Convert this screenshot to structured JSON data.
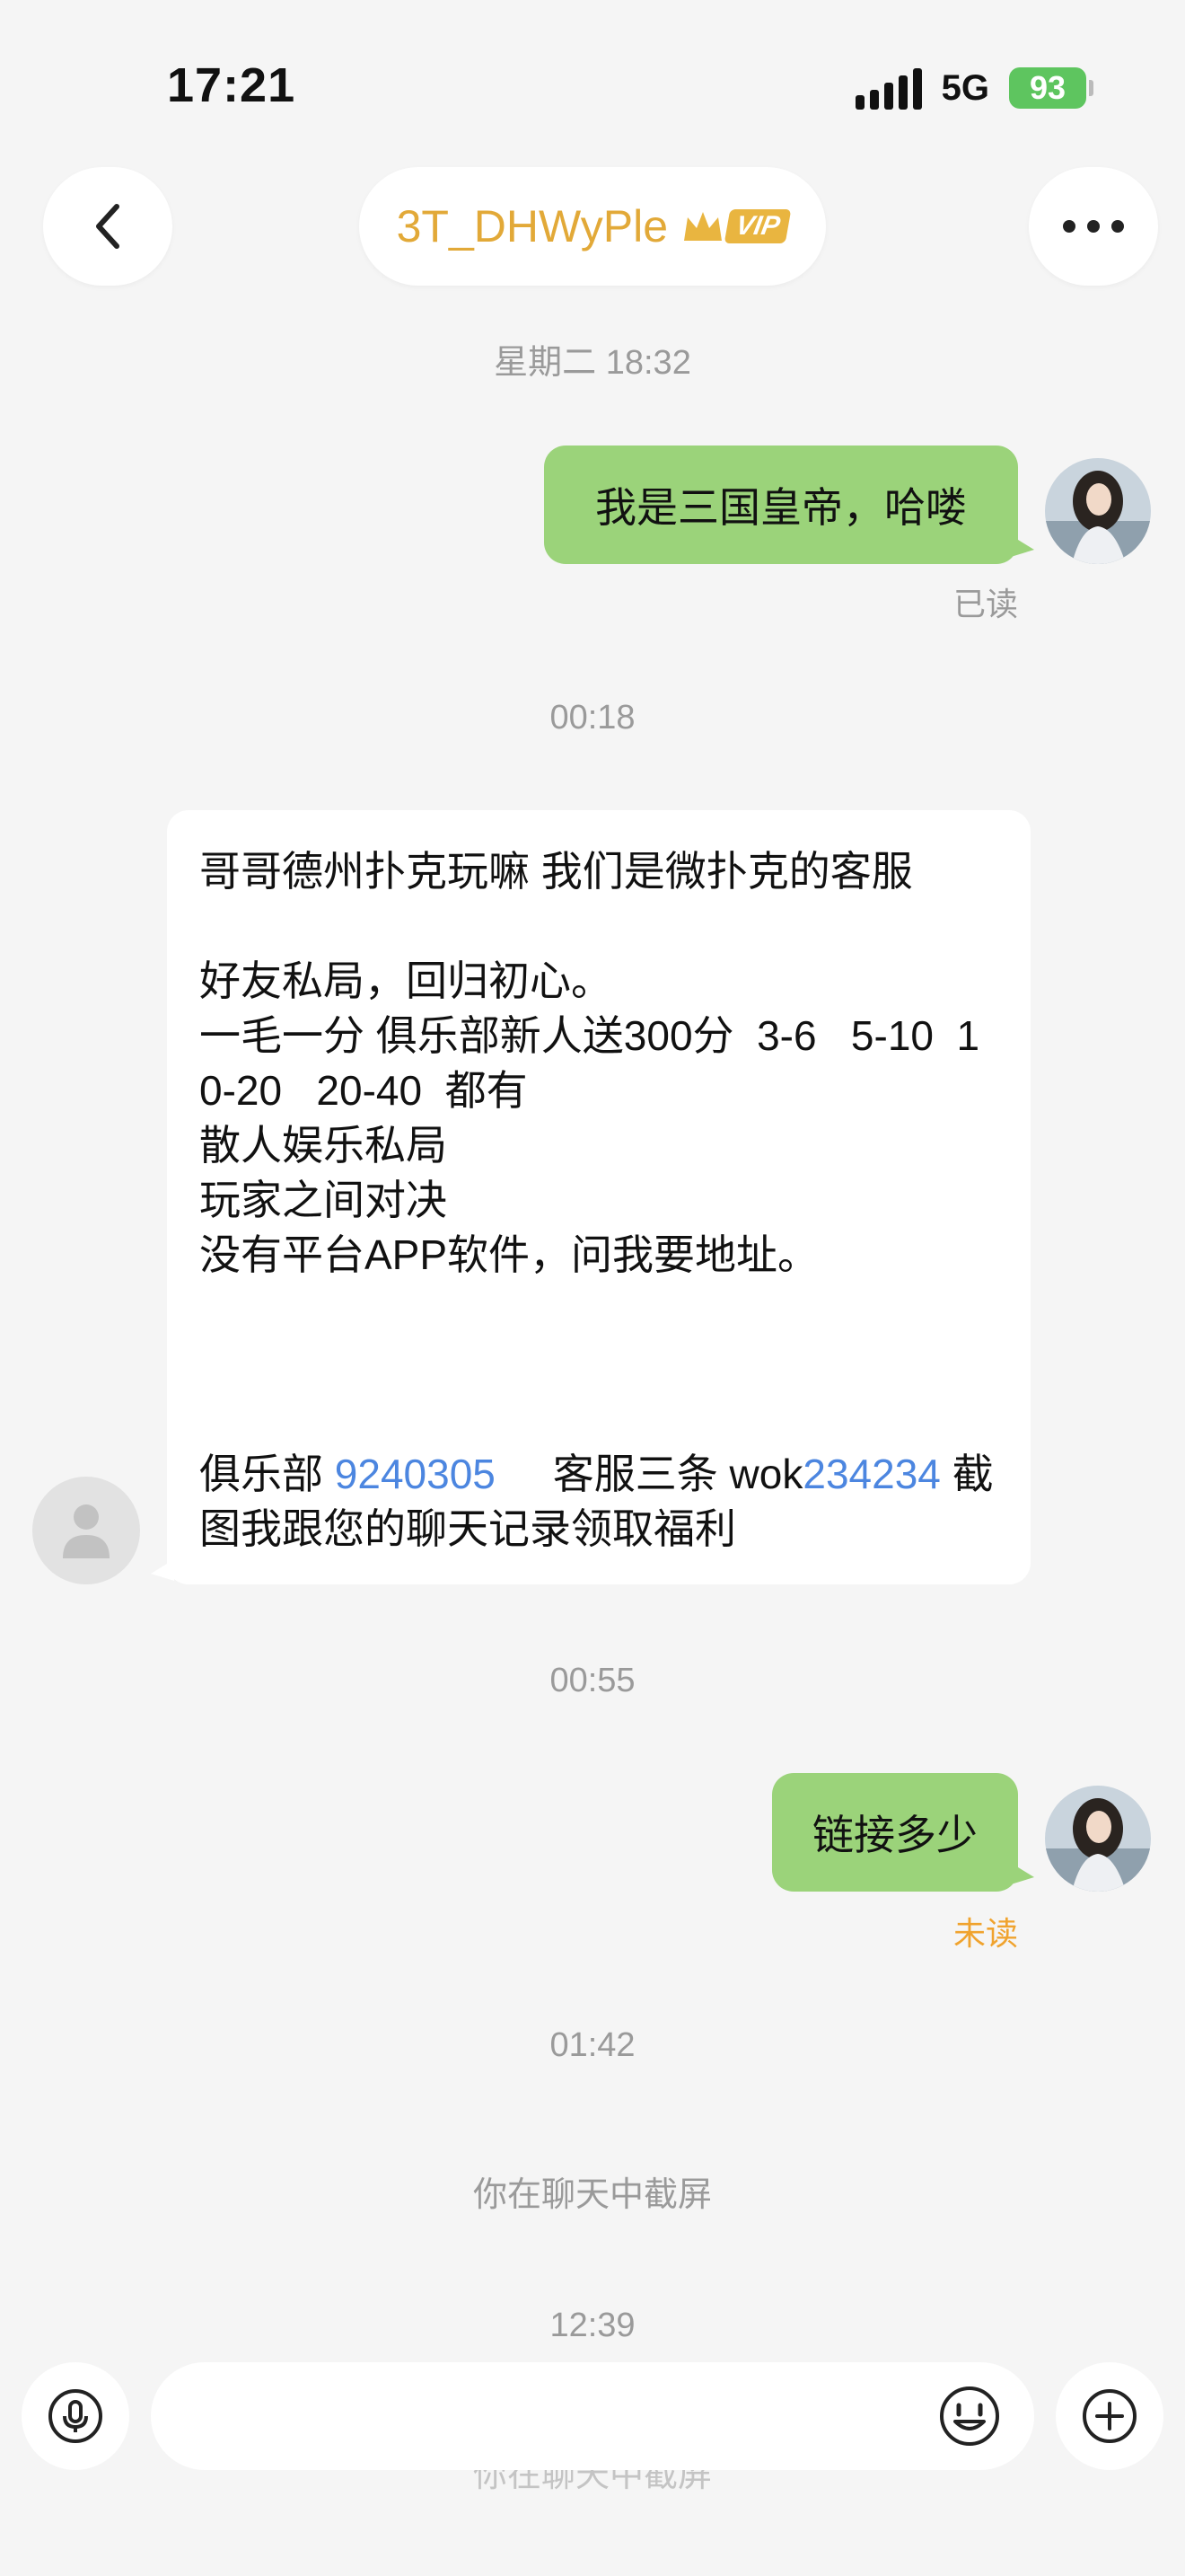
{
  "status_bar": {
    "time": "17:21",
    "network": "5G",
    "battery": "93"
  },
  "header": {
    "contact_name": "3T_DHWyPle",
    "vip_label": "VIP"
  },
  "timestamps": {
    "t1": "星期二 18:32",
    "t2": "00:18",
    "t3": "00:55",
    "t4": "01:42",
    "t5": "12:39"
  },
  "messages": {
    "m1_text": "我是三国皇帝，哈喽",
    "m1_status": "已读",
    "m2_lines": {
      "l1": "哥哥德州扑克玩嘛 我们是微扑克的客服",
      "l2": "好友私局，回归初心。",
      "l3": "一毛一分 俱乐部新人送300分  3-6   5-10  10-20   20-40  都有",
      "l4": "散人娱乐私局",
      "l5": "玩家之间对决",
      "l6": "没有平台APP软件，问我要地址。",
      "l7a": "俱乐部 ",
      "l7b": "9240305",
      "l7c": "     客服三条 wok",
      "l7d": "234234",
      "l7e": " 截图我跟您的聊天记录领取福利"
    },
    "m3_text": "链接多少",
    "m3_status": "未读"
  },
  "system_notes": {
    "screenshot_note_1": "你在聊天中截屏",
    "screenshot_note_2": "你在聊天中截屏"
  },
  "colors": {
    "accent_gold": "#e2a938",
    "bubble_green": "#9bd37a",
    "link_blue": "#4c86e0",
    "unread_orange": "#f0a32e",
    "read_gray": "#9a9a9a"
  },
  "icons": [
    "back-arrow-icon",
    "more-icon",
    "crown-icon",
    "voice-icon",
    "emoji-icon",
    "plus-icon"
  ]
}
